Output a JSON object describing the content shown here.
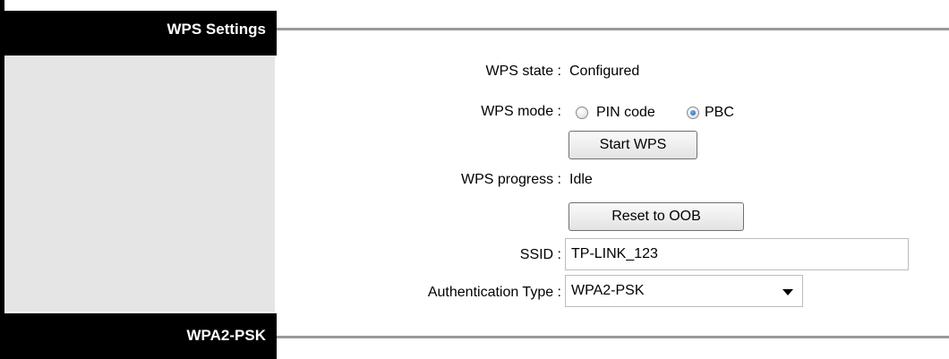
{
  "sections": {
    "top_title": "WPS Settings",
    "bottom_title": "WPA2-PSK"
  },
  "fields": {
    "wps_state_label": "WPS state :",
    "wps_state_value": "Configured",
    "wps_mode_label": "WPS mode :",
    "wps_mode_options": [
      "PIN code",
      "PBC"
    ],
    "wps_mode_selected": "PBC",
    "start_wps_button": "Start WPS",
    "wps_progress_label": "WPS progress :",
    "wps_progress_value": "Idle",
    "reset_button": "Reset to OOB",
    "ssid_label": "SSID :",
    "ssid_value": "TP-LINK_123",
    "auth_type_label": "Authentication Type :",
    "auth_type_value": "WPA2-PSK"
  },
  "icons": {
    "dropdown": "chevron-down-icon",
    "radio": "radio-icon"
  },
  "colors": {
    "header_bg": "#000000",
    "header_text": "#ffffff",
    "side_panel": "#e5e5e5",
    "rule": "#999999",
    "radio_selected": "#1f5fbf"
  }
}
